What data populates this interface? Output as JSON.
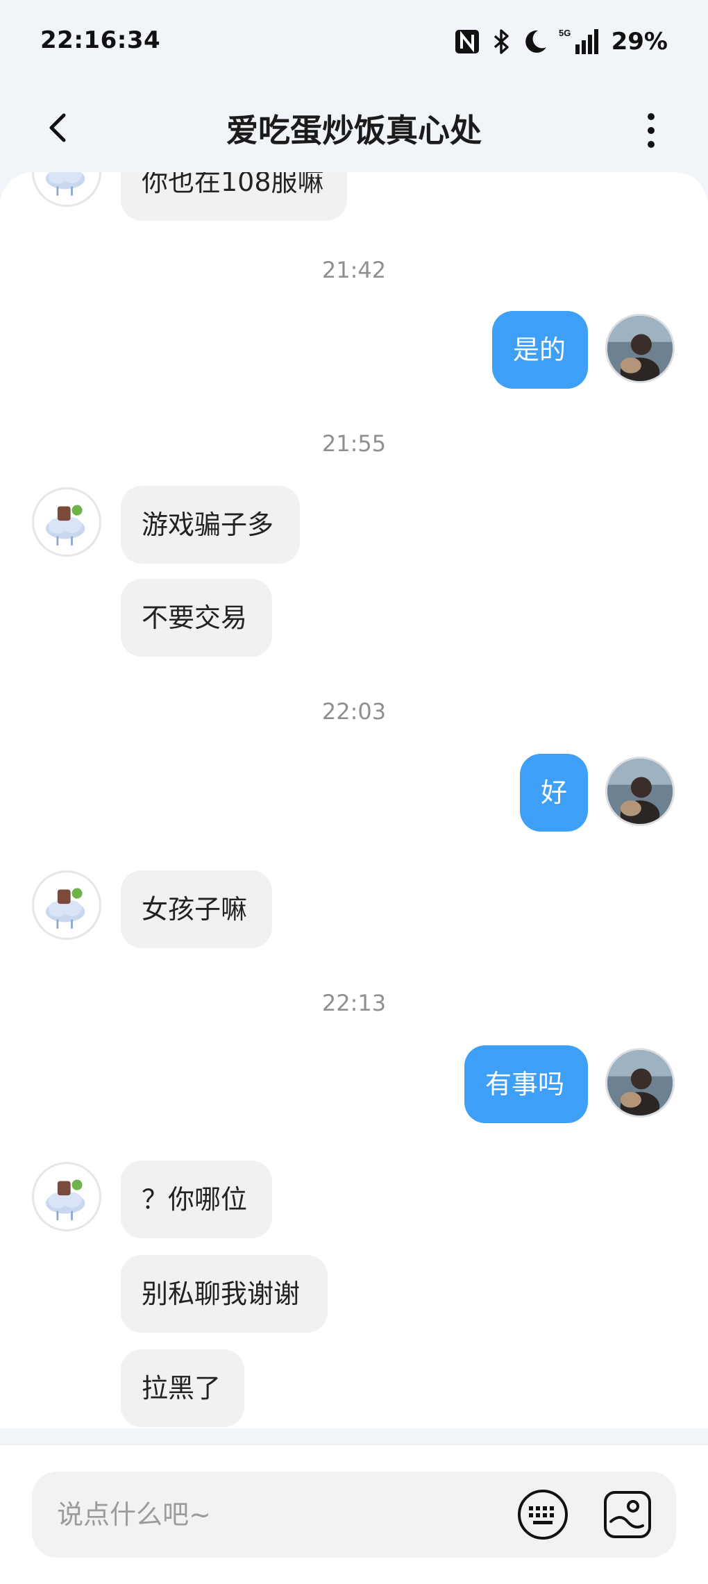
{
  "status_bar": {
    "time": "22:16:34",
    "network": "5G",
    "battery": "29%",
    "icons": [
      "nfc-icon",
      "bluetooth-icon",
      "moon-icon",
      "signal-icon"
    ]
  },
  "header": {
    "title": "爱吃蛋炒饭真心处",
    "back_icon": "chevron-left-icon",
    "more_icon": "more-vertical-icon"
  },
  "chat": {
    "partial_message": "你也在108服嘛",
    "timestamps": [
      "21:42",
      "21:55",
      "22:03",
      "22:13"
    ],
    "messages": {
      "m1": "是的",
      "m2": "游戏骗子多",
      "m3": "不要交易",
      "m4": "好",
      "m5": "女孩子嘛",
      "m6": "有事吗",
      "m7": "？你哪位",
      "m8": "别私聊我谢谢",
      "m9": "拉黑了"
    }
  },
  "composer": {
    "placeholder": "说点什么吧~",
    "keyboard_icon": "keyboard-icon",
    "sticker_icon": "sticker-icon"
  },
  "colors": {
    "outgoing_bubble": "#3d9ff5",
    "incoming_bubble": "#f1f1f3",
    "background": "#f1f4f8"
  }
}
